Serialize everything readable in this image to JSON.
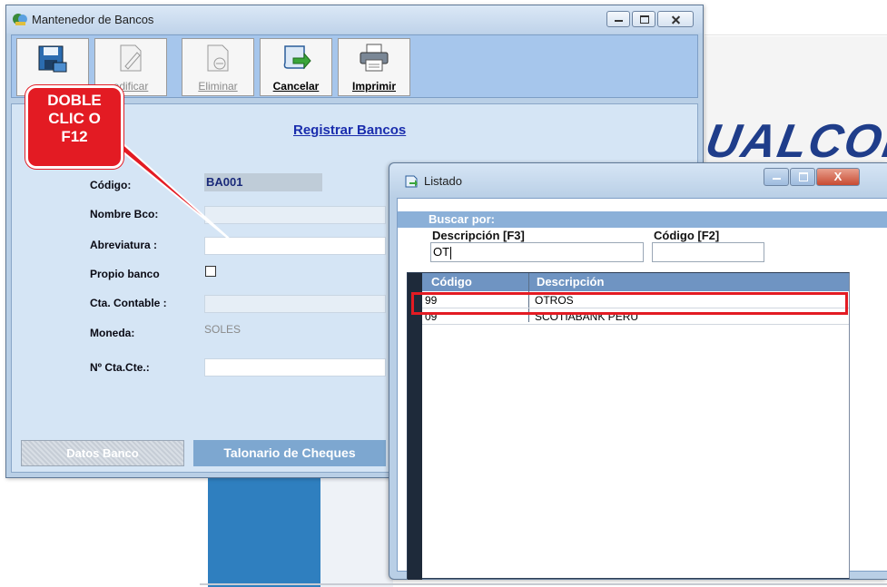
{
  "background": {
    "brand_fragment": "UALCONT"
  },
  "main_window": {
    "title": "Mantenedor de Bancos",
    "toolbar": {
      "buttons": [
        {
          "id": "save",
          "label": "",
          "icon": "floppy-disk-icon",
          "enabled": true
        },
        {
          "id": "modificar",
          "label": "Modificar",
          "visible_label": "odificar",
          "icon": "edit-document-icon",
          "enabled": false
        },
        {
          "id": "eliminar",
          "label": "Eliminar",
          "icon": "delete-document-icon",
          "enabled": false
        },
        {
          "id": "cancelar",
          "label": "Cancelar",
          "icon": "cancel-scroll-icon",
          "enabled": true
        },
        {
          "id": "imprimir",
          "label": "Imprimir",
          "icon": "printer-icon",
          "enabled": true
        }
      ]
    },
    "form": {
      "title": "Registrar Bancos",
      "fields": {
        "codigo_label": "Código:",
        "codigo_value": "BA001",
        "nombre_label": "Nombre Bco:",
        "nombre_value": "",
        "abreviatura_label": "Abreviatura :",
        "abreviatura_value": "",
        "propio_label": "Propio banco",
        "propio_checked": false,
        "cta_contable_label": "Cta. Contable :",
        "cta_contable_value": "",
        "moneda_label": "Moneda:",
        "moneda_value": "SOLES",
        "nro_cta_label": "Nº Cta.Cte.:",
        "nro_cta_value": ""
      },
      "tabs": [
        {
          "label": "Datos Banco",
          "active": true
        },
        {
          "label": "Talonario de Cheques",
          "active": false
        }
      ]
    }
  },
  "callout": {
    "line1": "DOBLE",
    "line2": "CLIC O",
    "line3": "F12",
    "color": "#e31b23"
  },
  "listado_window": {
    "title": "Listado",
    "close_glyph": "X",
    "search_header": "Buscar por:",
    "desc_label": "Descripción [F3]",
    "codigo_label": "Código [F2]",
    "desc_value": "OT",
    "codigo_value": "",
    "columns": [
      "Código",
      "Descripción"
    ],
    "rows": [
      {
        "codigo": "99",
        "descripcion": "OTROS",
        "highlighted": true
      },
      {
        "codigo": "09",
        "descripcion": "SCOTIABANK PERU",
        "highlighted": false
      }
    ],
    "highlight_color": "#e31b23"
  }
}
